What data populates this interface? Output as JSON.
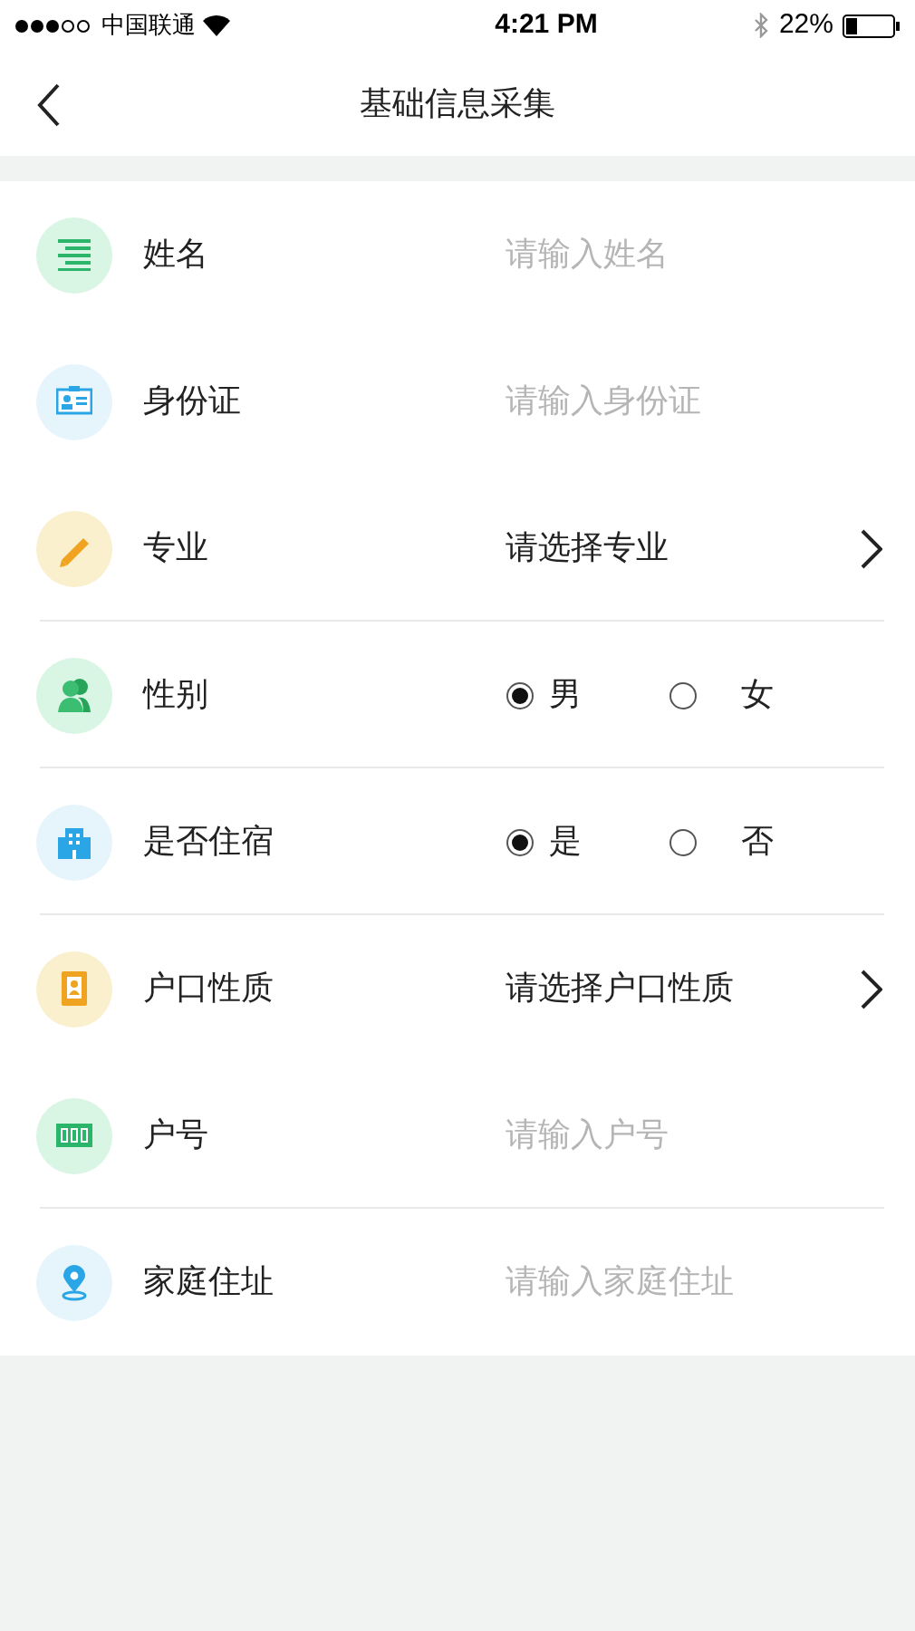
{
  "status_bar": {
    "carrier": "中国联通",
    "time": "4:21 PM",
    "battery": "22%"
  },
  "nav": {
    "title": "基础信息采集"
  },
  "form": [
    {
      "kind": "input",
      "label": "姓名",
      "placeholder": "请输入姓名",
      "divider_below": false
    },
    {
      "kind": "input",
      "label": "身份证",
      "placeholder": "请输入身份证",
      "divider_below": false
    },
    {
      "kind": "select",
      "label": "专业",
      "value": "请选择专业",
      "divider_below": true
    },
    {
      "kind": "radio",
      "label": "性别",
      "options": [
        {
          "label": "男",
          "selected": true
        },
        {
          "label": "女",
          "selected": false
        }
      ],
      "divider_below": true
    },
    {
      "kind": "radio",
      "label": "是否住宿",
      "options": [
        {
          "label": "是",
          "selected": true
        },
        {
          "label": "否",
          "selected": false
        }
      ],
      "divider_below": true
    },
    {
      "kind": "select",
      "label": "户口性质",
      "value": "请选择户口性质",
      "divider_below": false
    },
    {
      "kind": "input",
      "label": "户号",
      "placeholder": "请输入户号",
      "divider_below": true
    },
    {
      "kind": "input",
      "label": "家庭住址",
      "placeholder": "请输入家庭住址",
      "divider_below": false
    }
  ]
}
